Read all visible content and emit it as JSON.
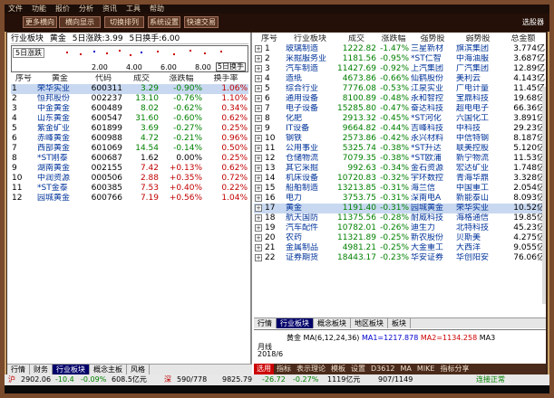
{
  "topbar": {
    "items": [
      "文件",
      "功能",
      "报价",
      "分析",
      "资讯",
      "工具",
      "帮助"
    ]
  },
  "toolbar": {
    "buttons": [
      "更多横向",
      "横向显示",
      "切换排列",
      "系统设置",
      "快速交易"
    ],
    "right": "选股器"
  },
  "left_panel": {
    "header": {
      "a": "行业板块",
      "b": "黄金",
      "c": "5日涨跌:3.99",
      "d": "5日换手:6.00"
    },
    "mini_chart": {
      "tag": "5日涨跌",
      "ticks": [
        "2.00",
        "4.00",
        "6.00",
        "8.00"
      ],
      "last_tick": "5日换手"
    },
    "columns": [
      "序号",
      "黄金",
      "代码",
      "成交",
      "涨跌幅",
      "换手率"
    ],
    "rows": [
      {
        "n": "1",
        "name": "荣华实业",
        "code": "600311",
        "price": "3.29",
        "chg": "-0.90%",
        "turn": "1.06%"
      },
      {
        "n": "2",
        "name": "恒邦股份",
        "code": "002237",
        "price": "13.10",
        "chg": "-0.76%",
        "turn": "1.10%"
      },
      {
        "n": "3",
        "name": "中金黄金",
        "code": "600489",
        "price": "8.02",
        "chg": "-0.62%",
        "turn": "0.34%"
      },
      {
        "n": "4",
        "name": "山东黄金",
        "code": "600547",
        "price": "31.60",
        "chg": "-0.60%",
        "turn": "0.62%"
      },
      {
        "n": "5",
        "name": "紫金矿业",
        "code": "601899",
        "price": "3.69",
        "chg": "-0.27%",
        "turn": "0.25%"
      },
      {
        "n": "6",
        "name": "赤峰黄金",
        "code": "600988",
        "price": "4.72",
        "chg": "-0.21%",
        "turn": "0.96%"
      },
      {
        "n": "7",
        "name": "西部黄金",
        "code": "601069",
        "price": "14.54",
        "chg": "-0.14%",
        "turn": "0.50%"
      },
      {
        "n": "8",
        "name": "*ST刚泰",
        "code": "600687",
        "price": "1.62",
        "chg": "0.00%",
        "turn": "0.25%"
      },
      {
        "n": "9",
        "name": "湖南黄金",
        "code": "002155",
        "price": "7.42",
        "chg": "+0.13%",
        "turn": "0.62%"
      },
      {
        "n": "10",
        "name": "中润资源",
        "code": "000506",
        "price": "2.88",
        "chg": "+0.35%",
        "turn": "0.72%"
      },
      {
        "n": "11",
        "name": "*ST金泰",
        "code": "600385",
        "price": "7.53",
        "chg": "+0.40%",
        "turn": "0.22%"
      },
      {
        "n": "12",
        "name": "园城黄金",
        "code": "600766",
        "price": "7.19",
        "chg": "+0.56%",
        "turn": "1.04%"
      }
    ],
    "tabs": [
      "行情",
      "财务",
      "行业板块",
      "概念主板",
      "风格"
    ]
  },
  "right_panel": {
    "columns": [
      "序号",
      "行业板块",
      "成交",
      "涨跌幅",
      "强势股",
      "弱势股",
      "总金额"
    ],
    "rows": [
      {
        "n": "1",
        "name": "玻璃制造",
        "vol": "1222.82",
        "chg": "-1.47%",
        "strong": "三星新材",
        "weak": "旗滨集团",
        "amt": "3.774亿"
      },
      {
        "n": "2",
        "name": "采掘服务业",
        "vol": "1181.56",
        "chg": "-0.95%",
        "strong": "*ST仁智",
        "weak": "中海油服",
        "amt": "3.687亿"
      },
      {
        "n": "3",
        "name": "汽车制造",
        "vol": "11427.69",
        "chg": "-0.92%",
        "strong": "上汽集团",
        "weak": "广汽集团",
        "amt": "12.89亿"
      },
      {
        "n": "4",
        "name": "造纸",
        "vol": "4673.86",
        "chg": "-0.66%",
        "strong": "仙鹤股份",
        "weak": "美利云",
        "amt": "4.143亿"
      },
      {
        "n": "5",
        "name": "综合行业",
        "vol": "7776.08",
        "chg": "-0.53%",
        "strong": "江泉实业",
        "weak": "广电计量",
        "amt": "11.45亿"
      },
      {
        "n": "6",
        "name": "通用设备",
        "vol": "8100.89",
        "chg": "-0.48%",
        "strong": "永和智控",
        "weak": "宝鼎科技",
        "amt": "19.68亿"
      },
      {
        "n": "7",
        "name": "电子设备",
        "vol": "15285.80",
        "chg": "-0.47%",
        "strong": "奋达科技",
        "weak": "超电电子",
        "amt": "66.36亿"
      },
      {
        "n": "8",
        "name": "化肥",
        "vol": "2913.32",
        "chg": "-0.45%",
        "strong": "*ST河化",
        "weak": "六国化工",
        "amt": "3.891亿"
      },
      {
        "n": "9",
        "name": "IT设备",
        "vol": "9664.82",
        "chg": "-0.44%",
        "strong": "吉峰科技",
        "weak": "中科技",
        "amt": "29.23亿"
      },
      {
        "n": "10",
        "name": "钢铁",
        "vol": "2573.86",
        "chg": "-0.42%",
        "strong": "永兴材料",
        "weak": "中信特钢",
        "amt": "8.187亿"
      },
      {
        "n": "11",
        "name": "公用事业",
        "vol": "5325.74",
        "chg": "-0.38%",
        "strong": "*ST升达",
        "weak": "联美控股",
        "amt": "5.120亿"
      },
      {
        "n": "12",
        "name": "仓储物流",
        "vol": "7079.35",
        "chg": "-0.38%",
        "strong": "*ST欧浦",
        "weak": "新宁物流",
        "amt": "11.53亿"
      },
      {
        "n": "13",
        "name": "其它采掘",
        "vol": "992.63",
        "chg": "-0.34%",
        "strong": "金石资源",
        "weak": "宏达矿业",
        "amt": "1.748亿"
      },
      {
        "n": "14",
        "name": "机床设备",
        "vol": "10720.83",
        "chg": "-0.32%",
        "strong": "宇环数控",
        "weak": "青海华鼎",
        "amt": "3.328亿"
      },
      {
        "n": "15",
        "name": "船舶制造",
        "vol": "13213.85",
        "chg": "-0.31%",
        "strong": "海兰信",
        "weak": "中国重工",
        "amt": "2.054亿"
      },
      {
        "n": "16",
        "name": "电力",
        "vol": "3753.75",
        "chg": "-0.31%",
        "strong": "深南电A",
        "weak": "新能泰山",
        "amt": "8.093亿"
      },
      {
        "n": "17",
        "name": "黄金",
        "vol": "1191.40",
        "chg": "-0.31%",
        "strong": "园城黄金",
        "weak": "荣华实业",
        "amt": "10.52亿"
      },
      {
        "n": "18",
        "name": "航天国防",
        "vol": "11375.56",
        "chg": "-0.28%",
        "strong": "耐威科技",
        "weak": "海格通信",
        "amt": "19.85亿"
      },
      {
        "n": "19",
        "name": "汽车配件",
        "vol": "10782.01",
        "chg": "-0.26%",
        "strong": "迪生力",
        "weak": "北特科技",
        "amt": "45.23亿"
      },
      {
        "n": "20",
        "name": "农药",
        "vol": "11321.89",
        "chg": "-0.25%",
        "strong": "新农股份",
        "weak": "贝斯美",
        "amt": "4.275亿"
      },
      {
        "n": "21",
        "name": "金属制品",
        "vol": "4981.21",
        "chg": "-0.25%",
        "strong": "大金重工",
        "weak": "大西洋",
        "amt": "9.055亿"
      },
      {
        "n": "22",
        "name": "证券期货",
        "vol": "18443.17",
        "chg": "-0.23%",
        "strong": "华安证券",
        "weak": "华创阳安",
        "amt": "76.06亿"
      }
    ],
    "tabs": [
      "行情",
      "行业板块",
      "概念板块",
      "地区板块",
      "板块"
    ],
    "ma": {
      "label": "黄金",
      "ma": "MA(6,12,24,36)",
      "ma1": "MA1=1217.878",
      "ma2": "MA2=1134.258",
      "ma3": "MA3",
      "date_label": "月线",
      "date": "2018/6"
    },
    "bottom": [
      "选用",
      "指标",
      "表示理论",
      "模板",
      "设置",
      "D3612",
      "MA",
      "MIKE",
      "指标分享"
    ]
  },
  "status": {
    "items": [
      "沪",
      "2902.06",
      "-10.4",
      "-0.09%",
      "608.5亿元",
      "深",
      "590/778",
      "9825.79",
      "-26.72",
      "-0.27%",
      "1119亿元",
      "907/1149",
      "连接正常"
    ]
  },
  "colors": {
    "frame": "#7a4a2c",
    "up": "#c00000",
    "down": "#008000",
    "selected": "#c8d8f0"
  }
}
